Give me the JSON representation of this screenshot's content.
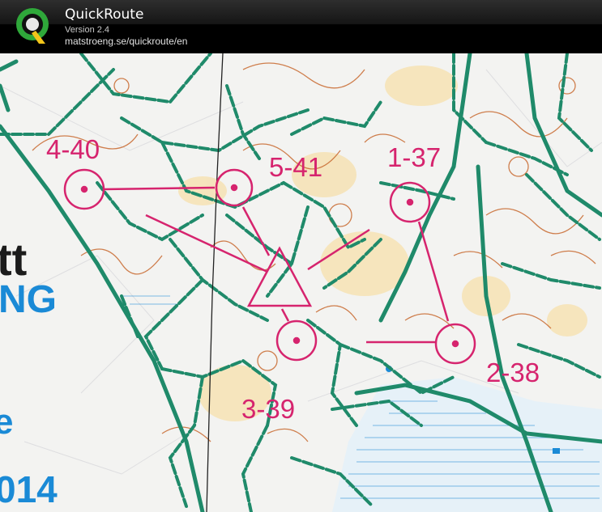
{
  "app": {
    "title": "QuickRoute",
    "version": "Version 2.4",
    "url": "matstroeng.se/quickroute/en",
    "logo_icon": "quickroute-q-logo-icon"
  },
  "map": {
    "colors": {
      "course": "#d6246e",
      "path": "#1f8a6a",
      "contour": "#c8692f",
      "blue": "#1a8ad6"
    },
    "controls": [
      {
        "label": "1-37"
      },
      {
        "label": "2-38"
      },
      {
        "label": "3-39"
      },
      {
        "label": "4-40"
      },
      {
        "label": "5-41"
      }
    ],
    "background_text": [
      "tt",
      "NG",
      "e",
      "014"
    ]
  }
}
